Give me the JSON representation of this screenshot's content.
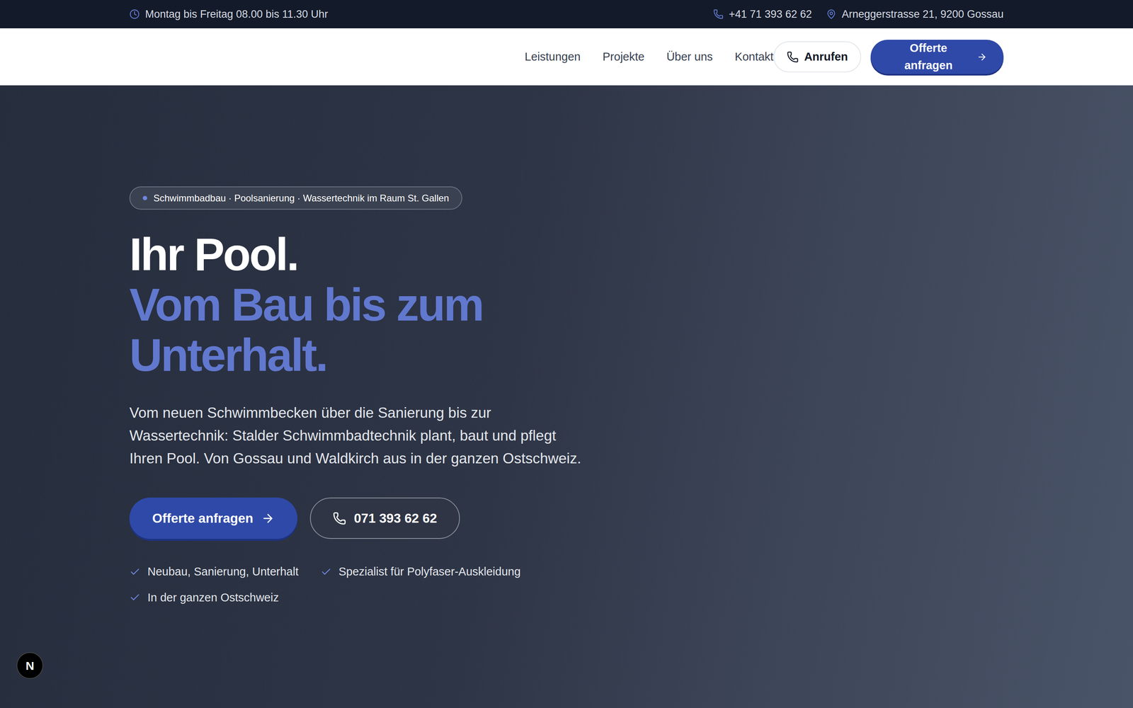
{
  "topbar": {
    "hours": "Montag bis Freitag 08.00 bis 11.30 Uhr",
    "phone": "+41 71 393 62 62",
    "address": "Arneggerstrasse 21, 9200 Gossau"
  },
  "nav": {
    "items": [
      {
        "label": "Leistungen",
        "selected": false
      },
      {
        "label": "Projekte",
        "selected": false
      },
      {
        "label": "Über uns",
        "selected": false
      },
      {
        "label": "Kontakt",
        "selected": false
      }
    ],
    "call_button": "Anrufen",
    "offer_button": "Offerte anfragen"
  },
  "hero": {
    "badge": "Schwimmbadbau · Poolsanierung · Wassertechnik im Raum St. Gallen",
    "headline": [
      "Ihr Pool.",
      "Vom Bau bis zum",
      "Unterhalt."
    ],
    "text": "Vom neuen Schwimmbecken über die Sanierung bis zur Wassertechnik: Stalder Schwimmbadtechnik plant, baut und pflegt Ihren Pool. Von Gossau und Waldkirch aus in der ganzen Ostschweiz.",
    "primary_cta": "Offerte anfragen",
    "phone_cta": "071 393 62 62",
    "checks": [
      "Neubau, Sanierung, Unterhalt",
      "Spezialist für Polyfaser-Auskleidung",
      "In der ganzen Ostschweiz"
    ]
  },
  "dev_badge": "N"
}
